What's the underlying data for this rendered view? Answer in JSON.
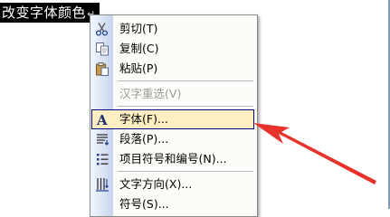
{
  "document": {
    "selected_text": "改变字体颜色",
    "paragraph_mark": "↵"
  },
  "context_menu": {
    "items": [
      {
        "label": "剪切",
        "accel": "(T)",
        "icon": "scissors-icon",
        "enabled": true
      },
      {
        "label": "复制",
        "accel": "(C)",
        "icon": "copy-icon",
        "enabled": true
      },
      {
        "label": "粘贴",
        "accel": "(P)",
        "icon": "paste-icon",
        "enabled": true
      },
      {
        "label": "汉字重选",
        "accel": "(V)",
        "icon": "",
        "enabled": false
      },
      {
        "label": "字体",
        "accel": "(F)...",
        "icon": "font-a-icon",
        "enabled": true,
        "highlighted": true
      },
      {
        "label": "段落",
        "accel": "(P)...",
        "icon": "paragraph-icon",
        "enabled": true
      },
      {
        "label": "项目符号和编号",
        "accel": "(N)...",
        "icon": "bullets-numbering-icon",
        "enabled": true
      },
      {
        "label": "文字方向",
        "accel": "(X)...",
        "icon": "text-direction-icon",
        "enabled": true
      },
      {
        "label": "符号",
        "accel": "(S)...",
        "icon": "",
        "enabled": true
      }
    ]
  },
  "colors": {
    "highlight_bg": "#ffeec2",
    "highlight_border": "#000080",
    "annotation_arrow": "#e8332c"
  }
}
